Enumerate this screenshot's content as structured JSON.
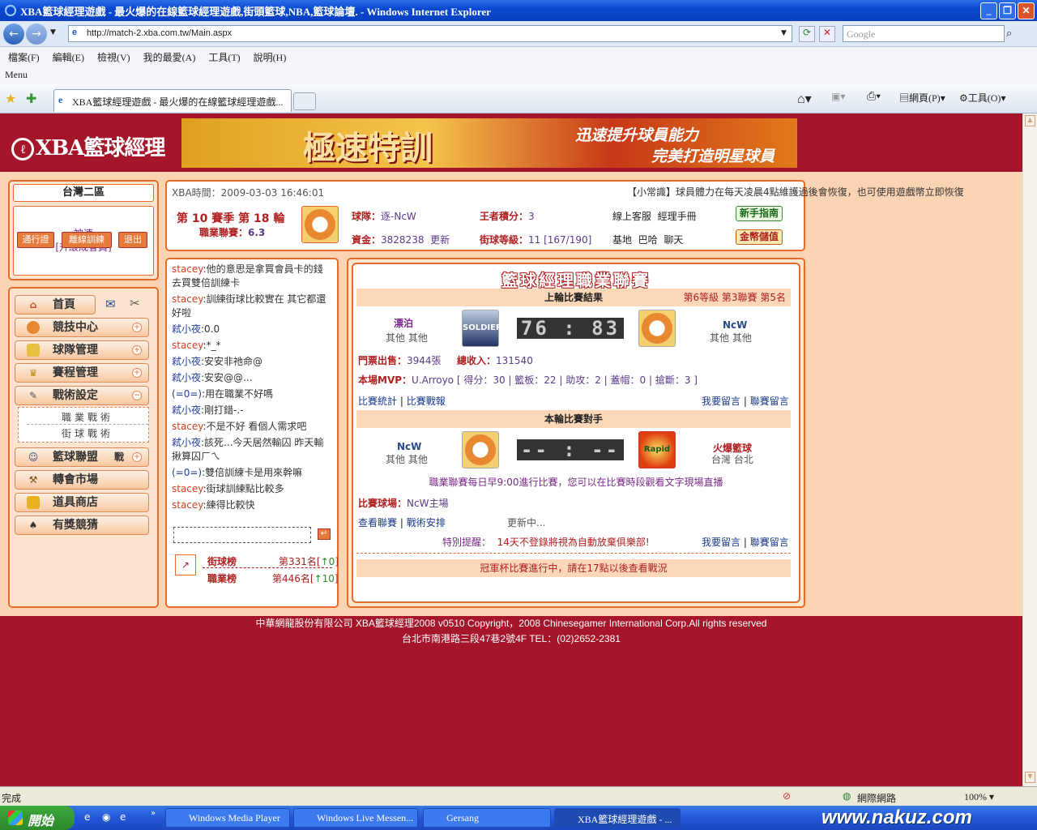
{
  "window": {
    "title": "XBA籃球經理遊戲 - 最火爆的在線籃球經理遊戲,街頭籃球,NBA,籃球論壇. - Windows Internet Explorer"
  },
  "browser": {
    "url": "http://match-2.xba.com.tw/Main.aspx",
    "search_placeholder": "Google",
    "menu": [
      "檔案(F)",
      "編輯(E)",
      "檢視(V)",
      "我的最愛(A)",
      "工具(T)",
      "說明(H)"
    ],
    "menu_label": "Menu",
    "tab_title": "XBA籃球經理遊戲 - 最火爆的在線籃球經理遊戲...",
    "tools": {
      "page": "網頁(P)",
      "tools": "工具(O)"
    },
    "status": "完成",
    "zone": "網際網路",
    "zoom": "100%"
  },
  "site": {
    "logo": "XBA籃球經理",
    "banner": {
      "main": "極速特訓",
      "line1": "迅速提升球員能力",
      "line2": "完美打造明星球員"
    }
  },
  "sidebar": {
    "server": "台灣二區",
    "username": "~神速~",
    "member": "[升級成會員]",
    "buttons": [
      "通行證",
      "離線訓練",
      "退出"
    ],
    "nav": [
      {
        "label": "首頁",
        "icon": "home-icon"
      },
      {
        "label": "競技中心",
        "icon": "basketball-icon"
      },
      {
        "label": "球隊管理",
        "icon": "jersey-icon"
      },
      {
        "label": "賽程管理",
        "icon": "trophy-icon"
      },
      {
        "label": "戰術設定",
        "icon": "tactics-icon"
      },
      {
        "label": "籃球聯盟",
        "icon": "league-icon"
      },
      {
        "label": "轉會市場",
        "icon": "hammer-icon"
      },
      {
        "label": "道具商店",
        "icon": "shop-icon"
      },
      {
        "label": "有獎競猜",
        "icon": "spade-icon"
      }
    ],
    "sub": [
      "職業戰術",
      "街球戰術"
    ],
    "league_tag": "戰"
  },
  "info": {
    "time": "XBA時間：2009-03-03 16:46:01",
    "ticker": "【小常識】球員體力在每天凌晨4點維護過後會恢復，也可使用遊戲幣立即恢復體力",
    "season": "第 10 賽季 第 18 輪",
    "pro_label": "職業聯賽：",
    "pro_val": "6.3",
    "team_label": "球隊：",
    "team_val": "逐-NcW",
    "king_label": "王者積分：",
    "king_val": "3",
    "service": "線上客服",
    "manual": "經理手冊",
    "money_label": "資金：",
    "money_val": "3828238",
    "update": "更新",
    "street_label": "街球等級：",
    "street_val": "11 [167/190]",
    "links": [
      "基地",
      "巴哈",
      "聊天"
    ],
    "guide_btn": "新手指南",
    "store_btn": "金幣儲值"
  },
  "chat": {
    "messages": [
      {
        "name": "stacey",
        "text": ":他的意思是拿買會員卡的錢去買雙倍訓練卡",
        "style": "n"
      },
      {
        "name": "stacey",
        "text": ":訓練街球比較實在  其它都還好啦",
        "style": "n"
      },
      {
        "name": "弒小夜",
        "text": ":0.0",
        "style": "b"
      },
      {
        "name": "stacey",
        "text": ":*_*",
        "style": "n"
      },
      {
        "name": "弒小夜",
        "text": ":安安非祂命@",
        "style": "b"
      },
      {
        "name": "弒小夜",
        "text": ":安安@@...",
        "style": "b"
      },
      {
        "name": "(=0=)",
        "text": ":用在職業不好嗎",
        "style": "b"
      },
      {
        "name": "弒小夜",
        "text": ":剛打錯-.-",
        "style": "b"
      },
      {
        "name": "stacey",
        "text": ":不是不好  看個人需求吧",
        "style": "n"
      },
      {
        "name": "弒小夜",
        "text": ":該死...今天居然輸囚 昨天輸揪算囚ㄏㄟ",
        "style": "b"
      },
      {
        "name": "(=0=)",
        "text": ":雙倍訓練卡是用來幹嘛",
        "style": "b"
      },
      {
        "name": "stacey",
        "text": ":街球訓練點比較多",
        "style": "n"
      },
      {
        "name": "stacey",
        "text": ":練得比較快",
        "style": "n"
      }
    ],
    "rank1_label": "街球榜",
    "rank1_val": "第331名",
    "rank1_delta": "↑0",
    "rank2_label": "職業榜",
    "rank2_val": "第446名",
    "rank2_delta": "↑10"
  },
  "board": {
    "title": "籃球經理職業聯賽",
    "last_header": "上輪比賽結果",
    "division": "第6等級 第3聯賽 第5名",
    "home_team": "漂泊",
    "home_loc": "其他 其他",
    "home_logo": "SOLDIER",
    "score": "76 : 83",
    "away_team": "NcW",
    "away_loc": "其他 其他",
    "ticket_label": "門票出售：",
    "ticket_val": "3944張",
    "income_label": "總收入：",
    "income_val": "131540",
    "mvp_label": "本場MVP：",
    "mvp_val": "U.Arroyo [ 得分：30 | 籃板：22 | 助攻：2 | 蓋帽：0 | 搶斷：3 ]",
    "stats_link": "比賽統計",
    "report_link": "比賽戰報",
    "msg_link": "我要留言",
    "league_msg_link": "聯賽留言",
    "next_header": "本輪比賽對手",
    "next_home": "NcW",
    "next_home_loc": "其他 其他",
    "next_score": "-- : --",
    "next_away": "火爆籃球",
    "next_away_loc": "台灣 台北",
    "next_away_logo": "Rapid",
    "schedule_note": "職業聯賽每日早9:00進行比賽，您可以在比賽時段觀看文字現場直播",
    "venue_label": "比賽球場：",
    "venue_val": "NcW主場",
    "view_league": "查看聯賽",
    "tactics_link": "戰術安排",
    "updating": "更新中...",
    "warning_label": "特別提醒：",
    "warning_val": "14天不登錄將視為自動放棄俱樂部!",
    "cup_note": "冠軍杯比賽進行中，請在17點以後查看戰況"
  },
  "footer": {
    "line1": "中華網龍股份有限公司  XBA籃球經理2008 v0510     Copyright，2008 Chinesegamer International Corp.All rights reserved",
    "line2": "台北市南港路三段47巷2號4F TEL：(02)2652-2381"
  },
  "taskbar": {
    "start": "開始",
    "tasks": [
      "Windows Media Player",
      "Windows Live Messen...",
      "Gersang",
      "XBA籃球經理遊戲 - ..."
    ],
    "watermark": "www.nakuz.com"
  }
}
